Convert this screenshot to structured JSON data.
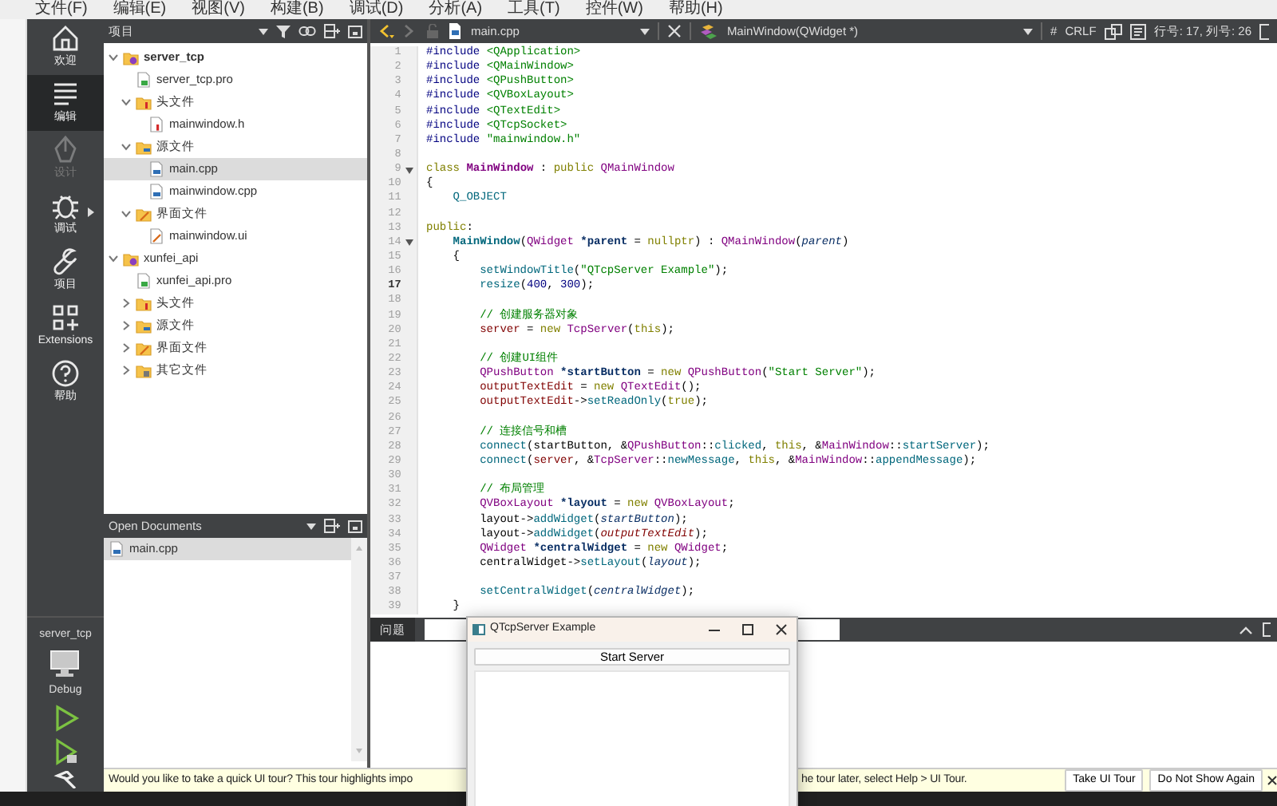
{
  "menu_bar": [
    "文件(F)",
    "编辑(E)",
    "视图(V)",
    "构建(B)",
    "调试(D)",
    "分析(A)",
    "工具(T)",
    "控件(W)",
    "帮助(H)"
  ],
  "mode_bar": {
    "items": [
      {
        "label": "欢迎",
        "kind": "home",
        "selected": false,
        "disabled": false,
        "submenu": false
      },
      {
        "label": "编辑",
        "kind": "edit",
        "selected": true,
        "disabled": false,
        "submenu": false
      },
      {
        "label": "设计",
        "kind": "design",
        "selected": false,
        "disabled": true,
        "submenu": false
      },
      {
        "label": "调试",
        "kind": "debug",
        "selected": false,
        "disabled": false,
        "submenu": true
      },
      {
        "label": "项目",
        "kind": "projects",
        "selected": false,
        "disabled": false,
        "submenu": false
      },
      {
        "label": "Extensions",
        "kind": "extensions",
        "selected": false,
        "disabled": false,
        "submenu": false
      },
      {
        "label": "帮助",
        "kind": "help",
        "selected": false,
        "disabled": false,
        "submenu": false
      }
    ],
    "target": {
      "project": "server_tcp",
      "build": "Debug"
    }
  },
  "projects_panel": {
    "title": "项目",
    "tree": [
      {
        "label": "server_tcp",
        "kind": "project",
        "active": true,
        "expanded": true,
        "selected": false,
        "children": [
          {
            "label": "server_tcp.pro",
            "kind": "pro",
            "selected": false
          },
          {
            "label": "头文件",
            "kind": "folder-h",
            "expanded": true,
            "selected": false,
            "children": [
              {
                "label": "mainwindow.h",
                "kind": "h",
                "selected": false
              }
            ]
          },
          {
            "label": "源文件",
            "kind": "folder-cpp",
            "expanded": true,
            "selected": false,
            "children": [
              {
                "label": "main.cpp",
                "kind": "cpp",
                "selected": true
              },
              {
                "label": "mainwindow.cpp",
                "kind": "cpp",
                "selected": false
              }
            ]
          },
          {
            "label": "界面文件",
            "kind": "folder-ui",
            "expanded": true,
            "selected": false,
            "children": [
              {
                "label": "mainwindow.ui",
                "kind": "ui",
                "selected": false
              }
            ]
          }
        ]
      },
      {
        "label": "xunfei_api",
        "kind": "project",
        "active": false,
        "expanded": true,
        "selected": false,
        "children": [
          {
            "label": "xunfei_api.pro",
            "kind": "pro",
            "selected": false
          },
          {
            "label": "头文件",
            "kind": "folder-h",
            "expanded": false,
            "selected": false
          },
          {
            "label": "源文件",
            "kind": "folder-cpp",
            "expanded": false,
            "selected": false
          },
          {
            "label": "界面文件",
            "kind": "folder-ui",
            "expanded": false,
            "selected": false
          },
          {
            "label": "其它文件",
            "kind": "folder-other",
            "expanded": false,
            "selected": false
          }
        ]
      }
    ]
  },
  "open_documents": {
    "title": "Open Documents",
    "items": [
      {
        "label": "main.cpp",
        "selected": true
      }
    ]
  },
  "editor": {
    "file": "main.cpp",
    "symbol": "MainWindow(QWidget *)",
    "encoding_mark": "#",
    "line_ending": "CRLF",
    "cursor": "行号: 17, 列号: 26",
    "lines": [
      {
        "number": "1",
        "current": false,
        "foldable": false,
        "tokens": [
          {
            "kind": "pp",
            "text": "#include "
          },
          {
            "kind": "inc",
            "text": "<QApplication>"
          }
        ]
      },
      {
        "number": "2",
        "current": false,
        "foldable": false,
        "tokens": [
          {
            "kind": "pp",
            "text": "#include "
          },
          {
            "kind": "inc",
            "text": "<QMainWindow>"
          }
        ]
      },
      {
        "number": "3",
        "current": false,
        "foldable": false,
        "tokens": [
          {
            "kind": "pp",
            "text": "#include "
          },
          {
            "kind": "inc",
            "text": "<QPushButton>"
          }
        ]
      },
      {
        "number": "4",
        "current": false,
        "foldable": false,
        "tokens": [
          {
            "kind": "pp",
            "text": "#include "
          },
          {
            "kind": "inc",
            "text": "<QVBoxLayout>"
          }
        ]
      },
      {
        "number": "5",
        "current": false,
        "foldable": false,
        "tokens": [
          {
            "kind": "pp",
            "text": "#include "
          },
          {
            "kind": "inc",
            "text": "<QTextEdit>"
          }
        ]
      },
      {
        "number": "6",
        "current": false,
        "foldable": false,
        "tokens": [
          {
            "kind": "pp",
            "text": "#include "
          },
          {
            "kind": "inc",
            "text": "<QTcpSocket>"
          }
        ]
      },
      {
        "number": "7",
        "current": false,
        "foldable": false,
        "tokens": [
          {
            "kind": "pp",
            "text": "#include "
          },
          {
            "kind": "str",
            "text": "\"mainwindow.h\""
          }
        ]
      },
      {
        "number": "8",
        "current": false,
        "foldable": false
      },
      {
        "number": "9",
        "current": false,
        "foldable": true,
        "tokens": [
          {
            "kind": "kw",
            "text": "class "
          },
          {
            "kind": "cls",
            "text": "MainWindow"
          },
          {
            "kind": "plain",
            "text": " : "
          },
          {
            "kind": "kw",
            "text": "public "
          },
          {
            "kind": "type",
            "text": "QMainWindow"
          }
        ]
      },
      {
        "number": "10",
        "current": false,
        "foldable": false,
        "tokens": [
          {
            "kind": "plain",
            "text": "{"
          }
        ]
      },
      {
        "number": "11",
        "current": false,
        "foldable": false,
        "tokens": [
          {
            "kind": "macro",
            "text": "    Q_OBJECT"
          }
        ]
      },
      {
        "number": "12",
        "current": false,
        "foldable": false
      },
      {
        "number": "13",
        "current": false,
        "foldable": false,
        "tokens": [
          {
            "kind": "kw",
            "text": "public"
          },
          {
            "kind": "plain",
            "text": ":"
          }
        ]
      },
      {
        "number": "14",
        "current": false,
        "foldable": true,
        "tokens": [
          {
            "kind": "ctor",
            "text": "    MainWindow"
          },
          {
            "kind": "plain",
            "text": "("
          },
          {
            "kind": "type",
            "text": "QWidget"
          },
          {
            "kind": "decl",
            "text": " *parent"
          },
          {
            "kind": "plain",
            "text": " = "
          },
          {
            "kind": "kw",
            "text": "nullptr"
          },
          {
            "kind": "plain",
            "text": ") : "
          },
          {
            "kind": "type",
            "text": "QMainWindow"
          },
          {
            "kind": "plain",
            "text": "("
          },
          {
            "kind": "param",
            "text": "parent"
          },
          {
            "kind": "plain",
            "text": ")"
          }
        ]
      },
      {
        "number": "15",
        "current": false,
        "foldable": false,
        "tokens": [
          {
            "kind": "plain",
            "text": "    {"
          }
        ]
      },
      {
        "number": "16",
        "current": false,
        "foldable": false,
        "tokens": [
          {
            "kind": "fn",
            "text": "        setWindowTitle"
          },
          {
            "kind": "plain",
            "text": "("
          },
          {
            "kind": "str",
            "text": "\"QTcpServer Example\""
          },
          {
            "kind": "plain",
            "text": ");"
          }
        ]
      },
      {
        "number": "17",
        "current": true,
        "foldable": false,
        "tokens": [
          {
            "kind": "fn",
            "text": "        resize"
          },
          {
            "kind": "plain",
            "text": "("
          },
          {
            "kind": "num",
            "text": "400"
          },
          {
            "kind": "plain",
            "text": ", "
          },
          {
            "kind": "num",
            "text": "300"
          },
          {
            "kind": "plain",
            "text": ");"
          }
        ]
      },
      {
        "number": "18",
        "current": false,
        "foldable": false
      },
      {
        "number": "19",
        "current": false,
        "foldable": false,
        "tokens": [
          {
            "kind": "comment",
            "text": "        // 创建服务器对象"
          }
        ]
      },
      {
        "number": "20",
        "current": false,
        "foldable": false,
        "tokens": [
          {
            "kind": "member",
            "text": "        server"
          },
          {
            "kind": "plain",
            "text": " = "
          },
          {
            "kind": "kw",
            "text": "new "
          },
          {
            "kind": "type",
            "text": "TcpServer"
          },
          {
            "kind": "plain",
            "text": "("
          },
          {
            "kind": "kw",
            "text": "this"
          },
          {
            "kind": "plain",
            "text": ");"
          }
        ]
      },
      {
        "number": "21",
        "current": false,
        "foldable": false
      },
      {
        "number": "22",
        "current": false,
        "foldable": false,
        "tokens": [
          {
            "kind": "comment",
            "text": "        // 创建UI组件"
          }
        ]
      },
      {
        "number": "23",
        "current": false,
        "foldable": false,
        "tokens": [
          {
            "kind": "type",
            "text": "        QPushButton"
          },
          {
            "kind": "decl",
            "text": " *startButton"
          },
          {
            "kind": "plain",
            "text": " = "
          },
          {
            "kind": "kw",
            "text": "new "
          },
          {
            "kind": "type",
            "text": "QPushButton"
          },
          {
            "kind": "plain",
            "text": "("
          },
          {
            "kind": "str",
            "text": "\"Start Server\""
          },
          {
            "kind": "plain",
            "text": ");"
          }
        ]
      },
      {
        "number": "24",
        "current": false,
        "foldable": false,
        "tokens": [
          {
            "kind": "member",
            "text": "        outputTextEdit"
          },
          {
            "kind": "plain",
            "text": " = "
          },
          {
            "kind": "kw",
            "text": "new "
          },
          {
            "kind": "type",
            "text": "QTextEdit"
          },
          {
            "kind": "plain",
            "text": "();"
          }
        ]
      },
      {
        "number": "25",
        "current": false,
        "foldable": false,
        "tokens": [
          {
            "kind": "member",
            "text": "        outputTextEdit"
          },
          {
            "kind": "plain",
            "text": "->"
          },
          {
            "kind": "fn",
            "text": "setReadOnly"
          },
          {
            "kind": "plain",
            "text": "("
          },
          {
            "kind": "kw",
            "text": "true"
          },
          {
            "kind": "plain",
            "text": ");"
          }
        ]
      },
      {
        "number": "26",
        "current": false,
        "foldable": false
      },
      {
        "number": "27",
        "current": false,
        "foldable": false,
        "tokens": [
          {
            "kind": "comment",
            "text": "        // 连接信号和槽"
          }
        ]
      },
      {
        "number": "28",
        "current": false,
        "foldable": false,
        "tokens": [
          {
            "kind": "fn",
            "text": "        connect"
          },
          {
            "kind": "plain",
            "text": "(startButton, &"
          },
          {
            "kind": "type",
            "text": "QPushButton"
          },
          {
            "kind": "plain",
            "text": "::"
          },
          {
            "kind": "fn",
            "text": "clicked"
          },
          {
            "kind": "plain",
            "text": ", "
          },
          {
            "kind": "kw",
            "text": "this"
          },
          {
            "kind": "plain",
            "text": ", &"
          },
          {
            "kind": "type",
            "text": "MainWindow"
          },
          {
            "kind": "plain",
            "text": "::"
          },
          {
            "kind": "fn",
            "text": "startServer"
          },
          {
            "kind": "plain",
            "text": ");"
          }
        ]
      },
      {
        "number": "29",
        "current": false,
        "foldable": false,
        "tokens": [
          {
            "kind": "fn",
            "text": "        connect"
          },
          {
            "kind": "plain",
            "text": "("
          },
          {
            "kind": "member",
            "text": "server"
          },
          {
            "kind": "plain",
            "text": ", &"
          },
          {
            "kind": "type",
            "text": "TcpServer"
          },
          {
            "kind": "plain",
            "text": "::"
          },
          {
            "kind": "fn",
            "text": "newMessage"
          },
          {
            "kind": "plain",
            "text": ", "
          },
          {
            "kind": "kw",
            "text": "this"
          },
          {
            "kind": "plain",
            "text": ", &"
          },
          {
            "kind": "type",
            "text": "MainWindow"
          },
          {
            "kind": "plain",
            "text": "::"
          },
          {
            "kind": "fn",
            "text": "appendMessage"
          },
          {
            "kind": "plain",
            "text": ");"
          }
        ]
      },
      {
        "number": "30",
        "current": false,
        "foldable": false
      },
      {
        "number": "31",
        "current": false,
        "foldable": false,
        "tokens": [
          {
            "kind": "comment",
            "text": "        // 布局管理"
          }
        ]
      },
      {
        "number": "32",
        "current": false,
        "foldable": false,
        "tokens": [
          {
            "kind": "type",
            "text": "        QVBoxLayout"
          },
          {
            "kind": "decl",
            "text": " *layout"
          },
          {
            "kind": "plain",
            "text": " = "
          },
          {
            "kind": "kw",
            "text": "new "
          },
          {
            "kind": "type",
            "text": "QVBoxLayout"
          },
          {
            "kind": "plain",
            "text": ";"
          }
        ]
      },
      {
        "number": "33",
        "current": false,
        "foldable": false,
        "tokens": [
          {
            "kind": "plain",
            "text": "        layout->"
          },
          {
            "kind": "fn",
            "text": "addWidget"
          },
          {
            "kind": "plain",
            "text": "("
          },
          {
            "kind": "param",
            "text": "startButton"
          },
          {
            "kind": "plain",
            "text": ");"
          }
        ]
      },
      {
        "number": "34",
        "current": false,
        "foldable": false,
        "tokens": [
          {
            "kind": "plain",
            "text": "        layout->"
          },
          {
            "kind": "fn",
            "text": "addWidget"
          },
          {
            "kind": "plain",
            "text": "("
          },
          {
            "kind": "memberit",
            "text": "outputTextEdit"
          },
          {
            "kind": "plain",
            "text": ");"
          }
        ]
      },
      {
        "number": "35",
        "current": false,
        "foldable": false,
        "tokens": [
          {
            "kind": "type",
            "text": "        QWidget"
          },
          {
            "kind": "decl",
            "text": " *centralWidget"
          },
          {
            "kind": "plain",
            "text": " = "
          },
          {
            "kind": "kw",
            "text": "new "
          },
          {
            "kind": "type",
            "text": "QWidget"
          },
          {
            "kind": "plain",
            "text": ";"
          }
        ]
      },
      {
        "number": "36",
        "current": false,
        "foldable": false,
        "tokens": [
          {
            "kind": "plain",
            "text": "        centralWidget->"
          },
          {
            "kind": "fn",
            "text": "setLayout"
          },
          {
            "kind": "plain",
            "text": "("
          },
          {
            "kind": "param",
            "text": "layout"
          },
          {
            "kind": "plain",
            "text": ");"
          }
        ]
      },
      {
        "number": "37",
        "current": false,
        "foldable": false
      },
      {
        "number": "38",
        "current": false,
        "foldable": false,
        "tokens": [
          {
            "kind": "fn",
            "text": "        setCentralWidget"
          },
          {
            "kind": "plain",
            "text": "("
          },
          {
            "kind": "param",
            "text": "centralWidget"
          },
          {
            "kind": "plain",
            "text": ");"
          }
        ]
      },
      {
        "number": "39",
        "current": false,
        "foldable": false,
        "tokens": [
          {
            "kind": "plain",
            "text": "    }"
          }
        ]
      }
    ]
  },
  "output_pane": {
    "tab": "问题"
  },
  "tour_bar": {
    "text_before": "Would you like to take a quick UI tour? This tour highlights impo",
    "text_after": "he tour later, select Help > UI Tour.",
    "buttons": [
      "Take UI Tour",
      "Do Not Show Again"
    ]
  },
  "floating_window": {
    "title": "QTcpServer Example",
    "button": "Start Server"
  }
}
